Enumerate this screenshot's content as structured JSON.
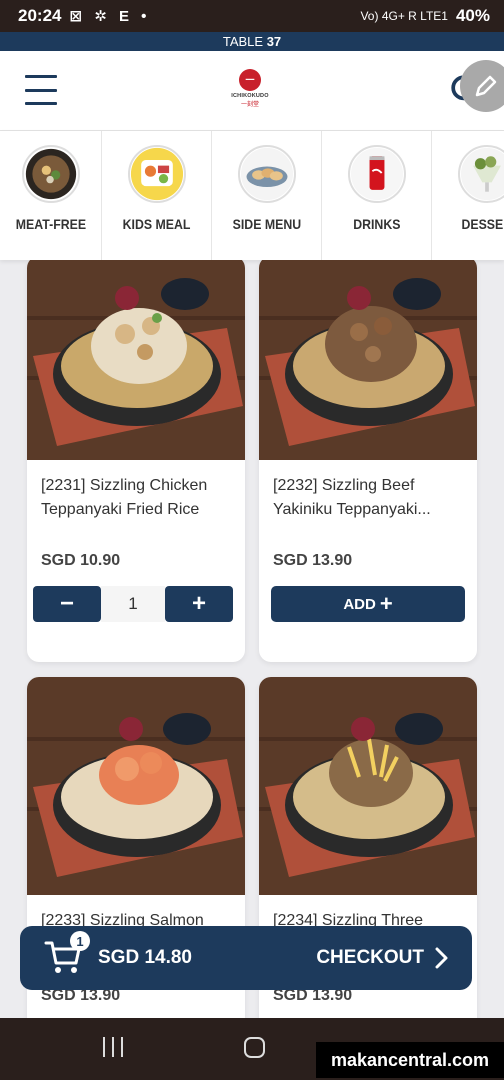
{
  "status_bar": {
    "time": "20:24",
    "left_icons": "⊠ ✲ E •",
    "network": "Vo) 4G+ R LTE1",
    "battery": "40%"
  },
  "table_bar": {
    "prefix": "TABLE",
    "number": "37"
  },
  "header": {
    "logo_text": "ICHIKOKUDO",
    "logo_sub": "一刻堂"
  },
  "categories": [
    {
      "label": "MEAT-FREE",
      "icon": "bowl-icon"
    },
    {
      "label": "KIDS MEAL",
      "icon": "kids-plate-icon"
    },
    {
      "label": "SIDE MENU",
      "icon": "gyoza-icon"
    },
    {
      "label": "DRINKS",
      "icon": "cola-can-icon"
    },
    {
      "label": "DESSER",
      "icon": "parfait-icon"
    }
  ],
  "products": [
    {
      "title": "[2231] Sizzling Chicken Teppanyaki Fried Rice",
      "price": "SGD 10.90",
      "qty": "1",
      "in_cart": true
    },
    {
      "title": "[2232] Sizzling Beef Yakiniku Teppanyaki...",
      "price": "SGD 13.90",
      "add_label": "ADD",
      "in_cart": false
    },
    {
      "title": "[2233] Sizzling Salmon",
      "price": "SGD 13.90"
    },
    {
      "title": "[2234] Sizzling Three",
      "price": "SGD 13.90"
    }
  ],
  "checkout": {
    "badge": "1",
    "total": "SGD 14.80",
    "label": "CHECKOUT"
  },
  "watermark": "makancentral.com",
  "colors": {
    "brand": "#1d3a5c",
    "logo_red": "#c8202b"
  }
}
